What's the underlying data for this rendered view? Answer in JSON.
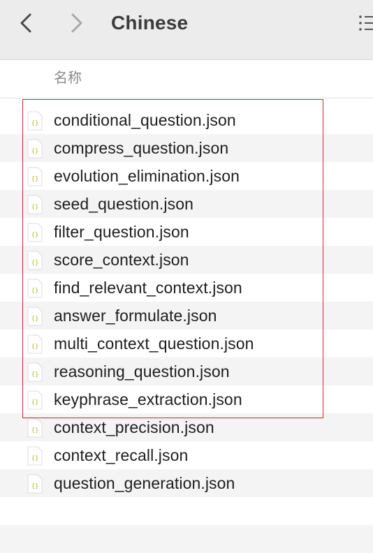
{
  "window": {
    "title": "Chinese"
  },
  "toolbar": {
    "back_icon": "chevron-left-icon",
    "forward_icon": "chevron-right-icon",
    "view_icon": "list-view-icon"
  },
  "columns": {
    "name_label": "名称"
  },
  "files": [
    {
      "name": "conditional_question.json",
      "icon": "json-file-icon"
    },
    {
      "name": "compress_question.json",
      "icon": "json-file-icon"
    },
    {
      "name": "evolution_elimination.json",
      "icon": "json-file-icon"
    },
    {
      "name": "seed_question.json",
      "icon": "json-file-icon"
    },
    {
      "name": "filter_question.json",
      "icon": "json-file-icon"
    },
    {
      "name": "score_context.json",
      "icon": "json-file-icon"
    },
    {
      "name": "find_relevant_context.json",
      "icon": "json-file-icon"
    },
    {
      "name": "answer_formulate.json",
      "icon": "json-file-icon"
    },
    {
      "name": "multi_context_question.json",
      "icon": "json-file-icon"
    },
    {
      "name": "reasoning_question.json",
      "icon": "json-file-icon"
    },
    {
      "name": "keyphrase_extraction.json",
      "icon": "json-file-icon"
    },
    {
      "name": "context_precision.json",
      "icon": "json-file-icon"
    },
    {
      "name": "context_recall.json",
      "icon": "json-file-icon"
    },
    {
      "name": "question_generation.json",
      "icon": "json-file-icon"
    }
  ],
  "colors": {
    "selection_outline": "#d4252a",
    "json_icon_accent": "#b5b82a"
  }
}
